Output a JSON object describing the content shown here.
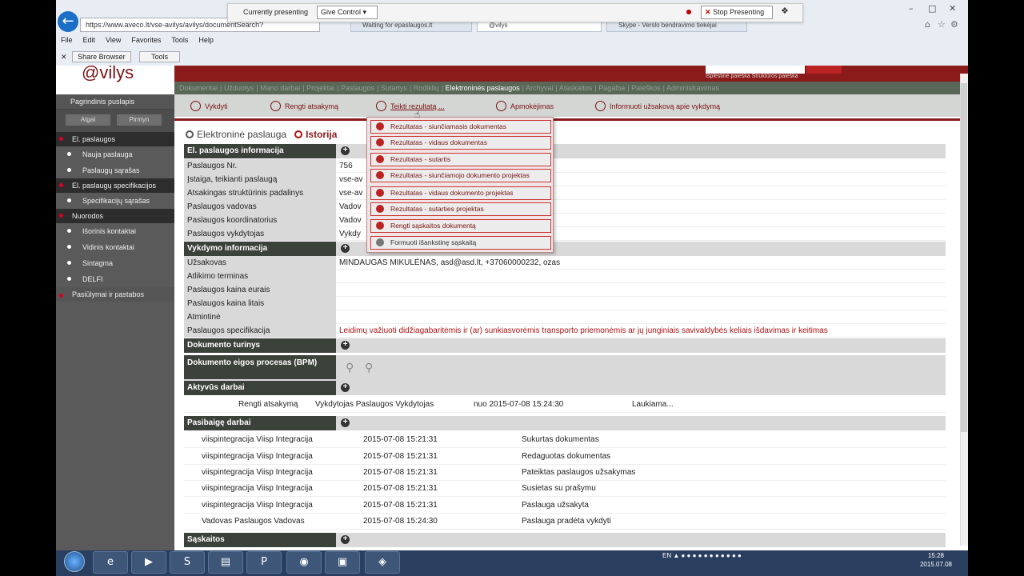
{
  "browser": {
    "url": "https://www.aveco.lt/vse-avilys/avilys/documentSearch?",
    "tabs": [
      "Waiting for epaslaugos.lt",
      "@vilys",
      "Skype - Verslo bendravimo tiekėjai"
    ],
    "menu": [
      "File",
      "Edit",
      "View",
      "Favorites",
      "Tools",
      "Help"
    ],
    "share_browser": "Share Browser",
    "tools": "Tools"
  },
  "presenting": {
    "label": "Currently presenting",
    "control": "Give Control",
    "stop": "Stop Presenting"
  },
  "app": {
    "logo": "@vilys",
    "search_links": "Išplėstinė paieška    Struktūros paieška",
    "nav": [
      "Dokumentai",
      "Užduotys",
      "Mano darbai",
      "Projektai",
      "Paslaugos",
      "Sutartys",
      "Rodiklių",
      "Elektroninės paslaugos",
      "Archyvai",
      "Ataskaitos",
      "Pagalba",
      "Paieškos",
      "Administravimas"
    ],
    "nav_active": "Elektroninės paslaugos"
  },
  "sidebar": {
    "title": "Pagrindinis puslapis",
    "prev": "Atgal",
    "next": "Pirmyn",
    "groups": [
      {
        "head": "El. paslaugos",
        "items": [
          "Nauja paslauga",
          "Paslaugų sąrašas"
        ]
      },
      {
        "head": "El. paslaugų specifikacijos",
        "items": [
          "Specifikacijų sąrašas"
        ]
      },
      {
        "head": "Nuorodos",
        "items": [
          "Išorinis kontaktai",
          "Vidinis kontaktai",
          "Sintagma",
          "DELFI"
        ]
      }
    ],
    "footer": "Pasiūlymai ir pastabos"
  },
  "toolbar": [
    "Vykdyti",
    "Rengti atsakymą",
    "Teikti rezultatą ...",
    "Apmokėjimas",
    "Informuoti užsakovą apie vykdymą"
  ],
  "dropdown": [
    "Rezultatas - siunčiamasis dokumentas",
    "Rezultatas - vidaus dokumentas",
    "Rezultatas - sutartis",
    "Rezultatas - siunčiamojo dokumento projektas",
    "Rezultatas - vidaus dokumento projektas",
    "Rezultatas - sutarties projektas",
    "Rengti sąskaitos dokumentą",
    "Formuoti išankstinę sąskaitą"
  ],
  "breadcrumb": {
    "first": "Elektroninė paslauga",
    "second": "Istorija"
  },
  "info": {
    "section": "El. paslaugos informacija",
    "rows": [
      {
        "k": "Paslaugos Nr.",
        "v": "756"
      },
      {
        "k": "Įstaiga, teikianti paslaugą",
        "v": "vse-av"
      },
      {
        "k": "Atsakingas struktūrinis padalinys",
        "v": "vse-av"
      },
      {
        "k": "Paslaugos vadovas",
        "v": "Vadov"
      },
      {
        "k": "Paslaugos koordinatorius",
        "v": "Vadov"
      },
      {
        "k": "Paslaugos vykdytojas",
        "v": "Vykdy"
      }
    ]
  },
  "exec": {
    "section": "Vykdymo informacija",
    "rows": [
      {
        "k": "Užsakovas",
        "v": "MINDAUGAS MIKULĖNAS, asd@asd.lt, +37060000232, ozas"
      },
      {
        "k": "Atlikimo terminas",
        "v": ""
      },
      {
        "k": "Paslaugos kaina eurais",
        "v": ""
      },
      {
        "k": "Paslaugos kaina litais",
        "v": ""
      },
      {
        "k": "Atmintinė",
        "v": ""
      },
      {
        "k": "Paslaugos specifikacija",
        "v": "Leidimų važiuoti didžiagabaritėmis ir (ar) sunkiasvorėmis transporto priemonėmis ar jų junginiais savivaldybės keliais išdavimas ir keitimas"
      }
    ]
  },
  "doc_content": "Dokumento turinys",
  "bpm": "Dokumento eigos procesas (BPM)",
  "active_works": {
    "section": "Aktyvūs darbai",
    "rows": [
      {
        "a": "Rengti atsakymą",
        "b": "Vykdytojas Paslaugos Vykdytojas",
        "c": "nuo 2015-07-08 15:24:30",
        "d": "Laukiama..."
      }
    ]
  },
  "finished_works": {
    "section": "Pasibaigę darbai",
    "rows": [
      {
        "a": "viispintegracija Viisp Integracija",
        "b": "2015-07-08 15:21:31",
        "c": "Sukurtas dokumentas"
      },
      {
        "a": "viispintegracija Viisp Integracija",
        "b": "2015-07-08 15:21:31",
        "c": "Redaguotas dokumentas"
      },
      {
        "a": "viispintegracija Viisp Integracija",
        "b": "2015-07-08 15:21:31",
        "c": "Pateiktas paslaugos užsakymas"
      },
      {
        "a": "viispintegracija Viisp Integracija",
        "b": "2015-07-08 15:21:31",
        "c": "Susietas su prašymu"
      },
      {
        "a": "viispintegracija Viisp Integracija",
        "b": "2015-07-08 15:21:31",
        "c": "Paslauga užsakyta"
      },
      {
        "a": "Vadovas Paslaugos Vadovas",
        "b": "2015-07-08 15:24:30",
        "c": "Paslauga pradėta vykdyti"
      }
    ]
  },
  "invoices": "Sąskaitos",
  "taskbar": {
    "lang": "EN",
    "time": "15:28",
    "date": "2015.07.08"
  }
}
